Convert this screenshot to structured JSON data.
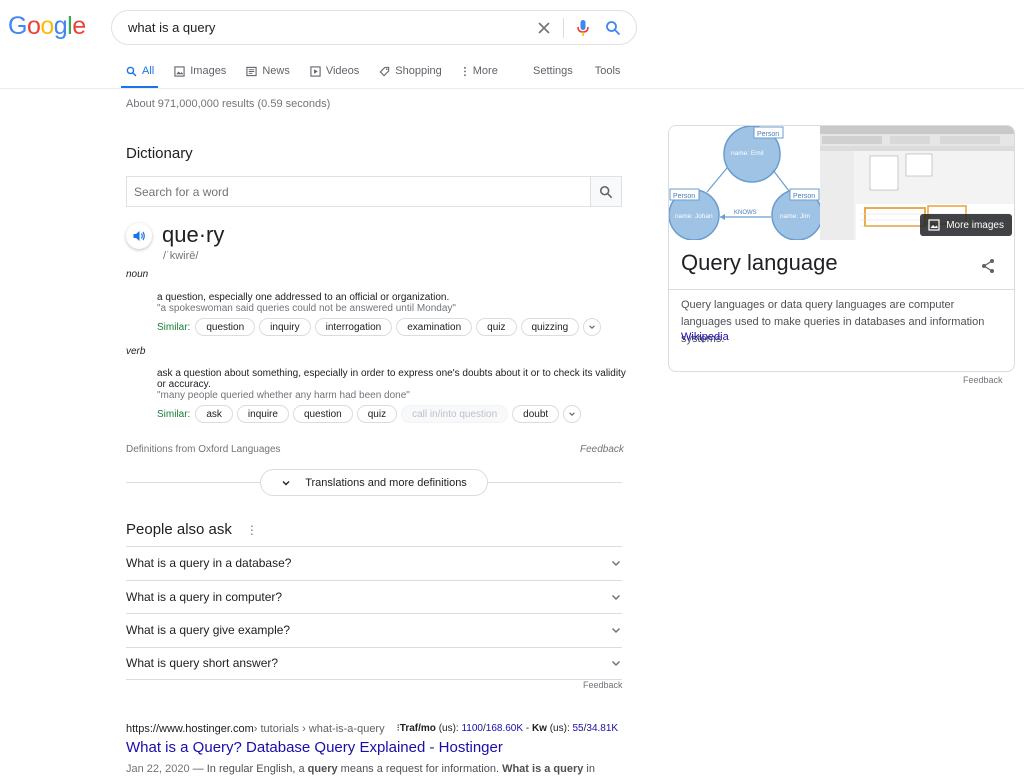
{
  "logo": {
    "letters": [
      "G",
      "o",
      "o",
      "g",
      "l",
      "e"
    ],
    "colors": [
      "#4285f4",
      "#ea4335",
      "#fbbc05",
      "#4285f4",
      "#34a853",
      "#ea4335"
    ]
  },
  "search": {
    "query": "what is a query"
  },
  "nav": {
    "tabs": [
      {
        "label": "All",
        "icon": "search-icon"
      },
      {
        "label": "Images",
        "icon": "image-icon"
      },
      {
        "label": "News",
        "icon": "news-icon"
      },
      {
        "label": "Videos",
        "icon": "video-icon"
      },
      {
        "label": "Shopping",
        "icon": "tag-icon"
      },
      {
        "label": "More",
        "icon": "more-vert-icon"
      }
    ],
    "settings": "Settings",
    "tools": "Tools"
  },
  "stats": "About 971,000,000 results (0.59 seconds)",
  "dictionary": {
    "title": "Dictionary",
    "placeholder": "Search for a word",
    "word": "que·ry",
    "phonetic": "/ˈkwirē/",
    "senses": [
      {
        "pos": "noun",
        "definition": "a question, especially one addressed to an official or organization.",
        "example": "\"a spokeswoman said queries could not be answered until Monday\"",
        "similar_label": "Similar:",
        "similar": [
          "question",
          "inquiry",
          "interrogation",
          "examination",
          "quiz",
          "quizzing"
        ]
      },
      {
        "pos": "verb",
        "definition": "ask a question about something, especially in order to express one's doubts about it or to check its validity or accuracy.",
        "example": "\"many people queried whether any harm had been done\"",
        "similar_label": "Similar:",
        "similar": [
          "ask",
          "inquire",
          "question",
          "quiz",
          "call in/into question",
          "doubt"
        ]
      }
    ],
    "source": "Definitions from Oxford Languages",
    "feedback": "Feedback",
    "more": "Translations and more definitions"
  },
  "paa": {
    "title": "People also ask",
    "questions": [
      "What is a query in a database?",
      "What is a query in computer?",
      "What is a query give example?",
      "What is query short answer?"
    ],
    "feedback": "Feedback"
  },
  "result": {
    "url": "https://www.hostinger.com",
    "crumbs": " › tutorials › what-is-a-query",
    "seo_traf_label": "Traf/mo",
    "seo_traf_suffix": " (us): ",
    "seo_traf_value": "1100",
    "seo_traf_sep": "/",
    "seo_traf_total": "168.60K",
    "seo_kw_sep": " - ",
    "seo_kw_label": "Kw",
    "seo_kw_suffix": " (us): ",
    "seo_kw_value": "55",
    "seo_kw_total_sep": "/",
    "seo_kw_total": "34.81K",
    "title": "What is a Query? Database Query Explained - Hostinger",
    "date": "Jan 22, 2020",
    "snippet_dash": " — In regular English, a ",
    "snippet_b1": "query",
    "snippet_mid": " means a request for information. ",
    "snippet_b2": "What is a query",
    "snippet_end": " in"
  },
  "knowledge_panel": {
    "more_images": "More images",
    "title": "Query language",
    "description": "Query languages or data query languages are computer languages used to make queries in databases and information systems.",
    "source": "Wikipedia",
    "feedback": "Feedback",
    "diagram": {
      "nodes": [
        "name: Emil",
        "name: Johan",
        "name: Jim"
      ],
      "node_label": "Person",
      "edge_label": "KNOWS"
    }
  }
}
